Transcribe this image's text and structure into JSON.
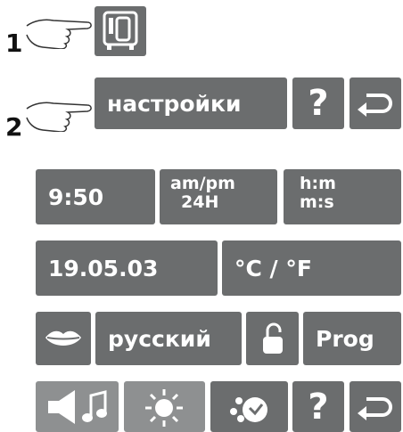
{
  "steps": {
    "one": "1",
    "two": "2"
  },
  "step2": {
    "button_label": "настройки"
  },
  "time": {
    "value": "9:50",
    "ampm_line1": "am/pm",
    "ampm_line2": "24H",
    "hms_line1": "h:m",
    "hms_line2": "m:s"
  },
  "date": {
    "value": "19.05.03",
    "units": "°C / °F"
  },
  "language": {
    "value": "русский",
    "prog_label": "Prog"
  },
  "help_glyph": "?",
  "colors": {
    "tile": "#6b6d6e",
    "tile_light": "#8e9091",
    "icon": "#ffffff"
  },
  "icons": [
    "pointing-hand-icon",
    "oven-icon",
    "help-icon",
    "back-arrow-icon",
    "lips-icon",
    "unlocked-padlock-icon",
    "sound-icon",
    "brightness-icon",
    "reset-icon"
  ]
}
